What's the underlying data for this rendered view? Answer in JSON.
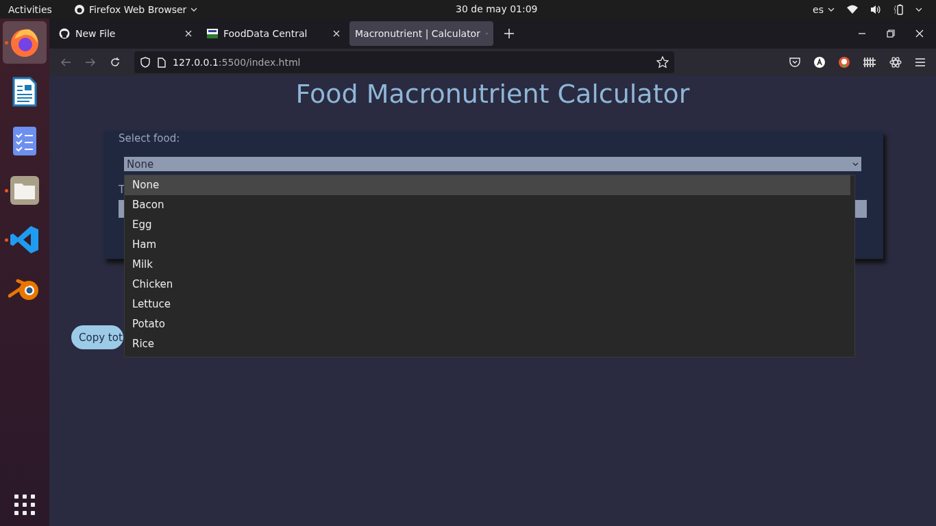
{
  "top_bar": {
    "activities": "Activities",
    "app_name": "Firefox Web Browser",
    "clock": "30 de may  01:09",
    "language": "es"
  },
  "dock": [
    {
      "kind": "firefox",
      "running": true,
      "selected": true
    },
    {
      "kind": "writer",
      "running": false,
      "selected": false
    },
    {
      "kind": "tasks",
      "running": false,
      "selected": false
    },
    {
      "kind": "files",
      "running": true,
      "selected": false
    },
    {
      "kind": "vscode",
      "running": true,
      "selected": false
    },
    {
      "kind": "blender",
      "running": false,
      "selected": false
    }
  ],
  "tabs": [
    {
      "kind": "github",
      "label": "New File",
      "selected": false
    },
    {
      "kind": "usda",
      "label": "FoodData Central",
      "selected": false
    },
    {
      "kind": "none",
      "label": "Macronutrient | Calculator",
      "selected": true
    }
  ],
  "url": {
    "host": "127.0.0.1",
    "rest": ":5500/index.html"
  },
  "page": {
    "title": "Food Macronutrient Calculator",
    "food_label": "Select food:",
    "food_select": "None",
    "second_label": "T",
    "copy_button": "Copy tot",
    "options": [
      {
        "label": "None",
        "selected": true
      },
      {
        "label": "Bacon",
        "selected": false
      },
      {
        "label": "Egg",
        "selected": false
      },
      {
        "label": "Ham",
        "selected": false
      },
      {
        "label": "Milk",
        "selected": false
      },
      {
        "label": "Chicken",
        "selected": false
      },
      {
        "label": "Lettuce",
        "selected": false
      },
      {
        "label": "Potato",
        "selected": false
      },
      {
        "label": "Rice",
        "selected": false
      }
    ]
  }
}
